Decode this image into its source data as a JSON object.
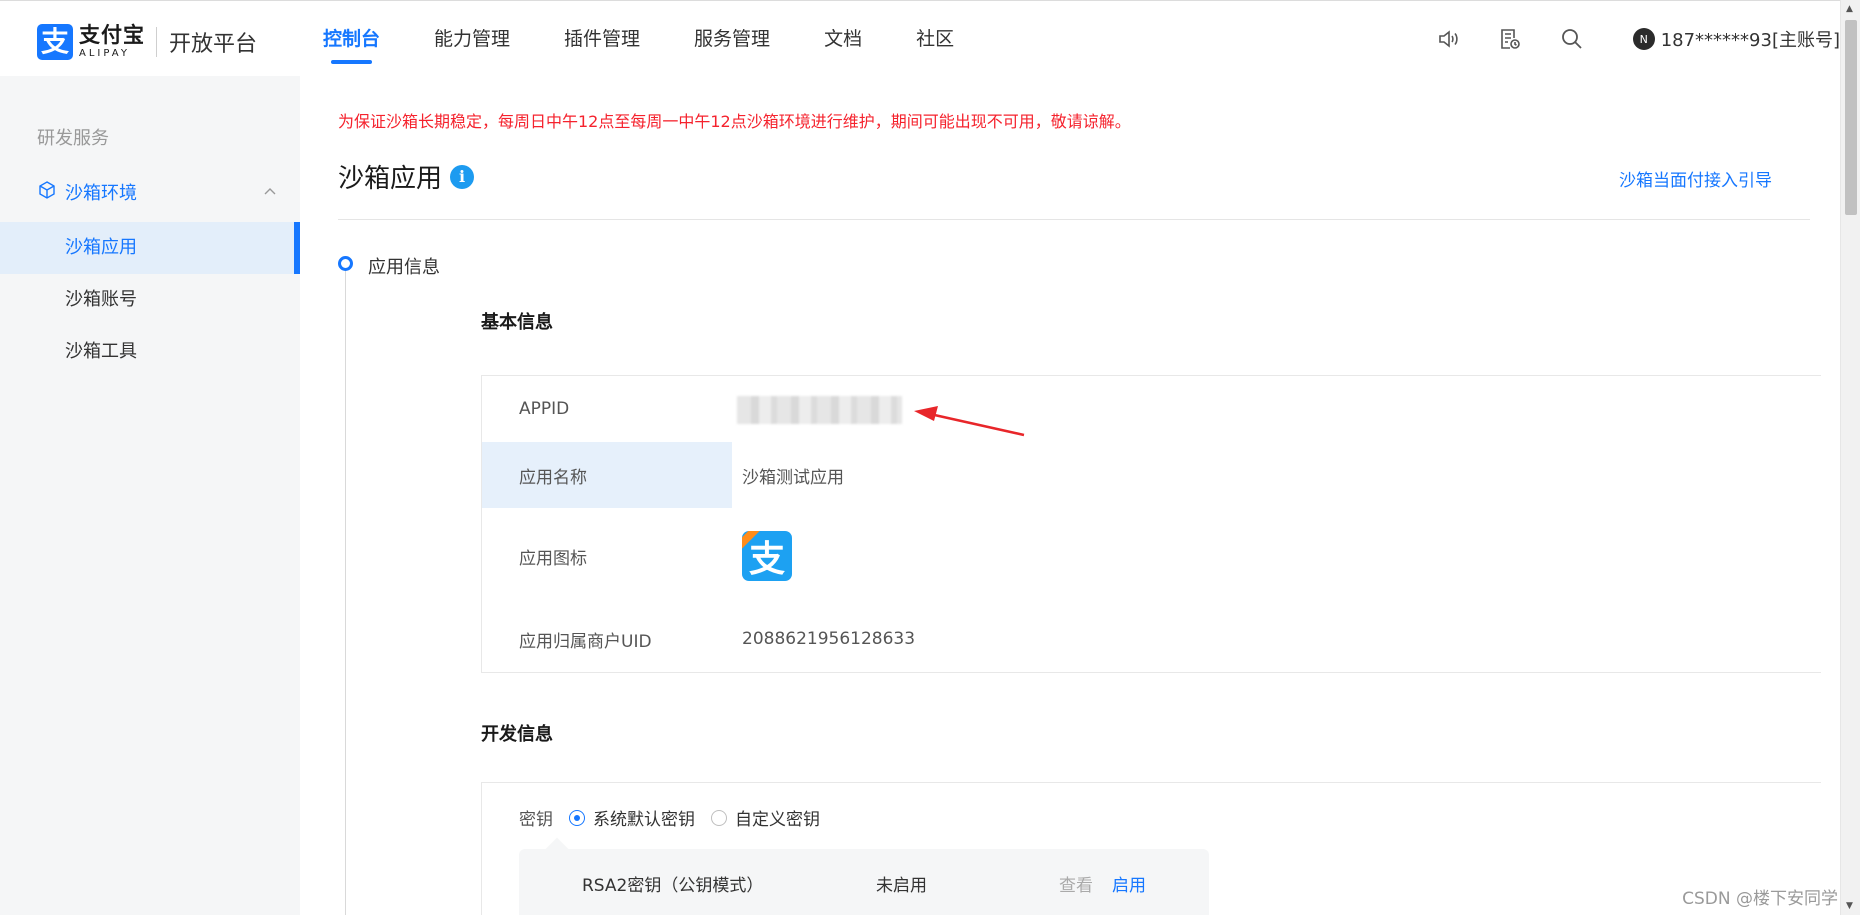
{
  "header": {
    "logo": {
      "mark": "支",
      "name_cn": "支付宝",
      "name_en": "ALIPAY",
      "platform": "开放平台"
    },
    "nav": [
      {
        "label": "控制台",
        "active": true
      },
      {
        "label": "能力管理"
      },
      {
        "label": "插件管理"
      },
      {
        "label": "服务管理"
      },
      {
        "label": "文档"
      },
      {
        "label": "社区"
      }
    ],
    "tools": [
      "speaker-icon",
      "notice-list-icon",
      "search-icon"
    ],
    "user": {
      "avatar": "N",
      "name": "187******93[主账号]"
    }
  },
  "sidebar": {
    "group_title": "研发服务",
    "section": {
      "label": "沙箱环境",
      "icon": "box-icon",
      "expanded": true
    },
    "items": [
      {
        "label": "沙箱应用",
        "active": true
      },
      {
        "label": "沙箱账号"
      },
      {
        "label": "沙箱工具"
      }
    ]
  },
  "main": {
    "notice": "为保证沙箱长期稳定，每周日中午12点至每周一中午12点沙箱环境进行维护，期间可能出现不可用，敬请谅解。",
    "title": "沙箱应用",
    "info_glyph": "i",
    "guide_link": "沙箱当面付接入引导",
    "step_label": "应用信息",
    "basic_info": {
      "title": "基本信息",
      "rows": [
        {
          "key": "APPID",
          "value": ""
        },
        {
          "key": "应用名称",
          "value": "沙箱测试应用"
        },
        {
          "key": "应用图标",
          "value": ""
        },
        {
          "key": "应用归属商户UID",
          "value": "2088621956128633"
        }
      ]
    },
    "dev_info": {
      "title": "开发信息",
      "key_label": "密钥",
      "options": [
        {
          "label": "系统默认密钥",
          "selected": true
        },
        {
          "label": "自定义密钥",
          "selected": false
        }
      ],
      "key_row": {
        "name": "RSA2密钥（公钥模式）",
        "status": "未启用",
        "view": "查看",
        "enable": "启用"
      }
    }
  },
  "watermark": "CSDN @楼下安同学",
  "colors": {
    "brand": "#1677ff",
    "notice": "#f5222d",
    "arrow": "#e8262a"
  }
}
